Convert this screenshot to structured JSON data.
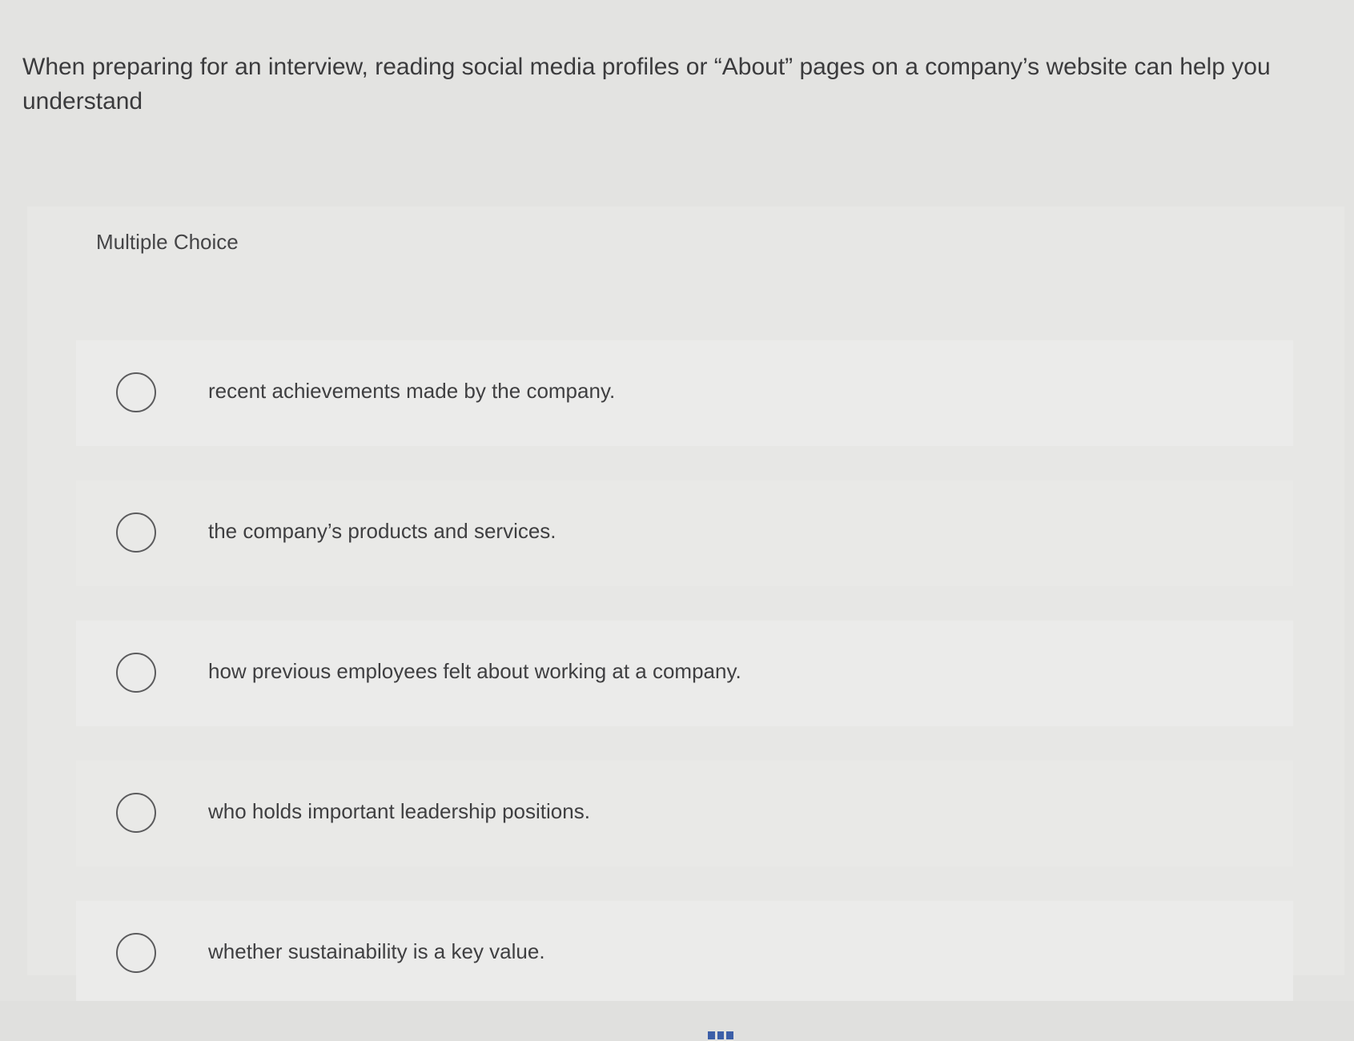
{
  "question": {
    "text": "When preparing for an interview, reading social media profiles or “About” pages on a company’s website can help you understand"
  },
  "question_type": "Multiple Choice",
  "options": [
    {
      "label": "recent achievements made by the company."
    },
    {
      "label": "the company’s products and services."
    },
    {
      "label": "how previous employees felt about working at a company."
    },
    {
      "label": "who holds important leadership positions."
    },
    {
      "label": "whether sustainability is a key value."
    }
  ],
  "icons": {
    "radio": "radio-circle-icon",
    "bottom": "grid-icon"
  },
  "colors": {
    "background": "#e3e3e1",
    "text": "#3b3b3d",
    "radio_border": "#5b5b5d",
    "grid_icon": "#3c5fa8"
  }
}
